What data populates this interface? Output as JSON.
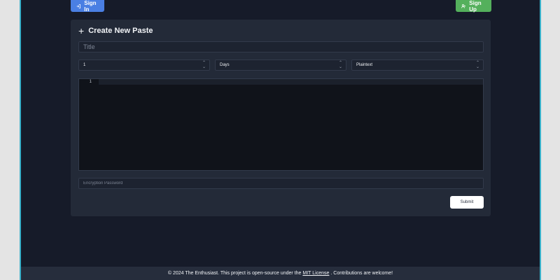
{
  "header": {
    "signin_label": "Sign In",
    "signup_label": "Sign Up"
  },
  "form": {
    "title": "Create New Paste",
    "title_placeholder": "Title",
    "expiry_value": "1",
    "expiry_unit": "Days",
    "syntax": "Plaintext",
    "editor_line_number": "1",
    "password_placeholder": "Encryption Password",
    "submit_label": "Submit"
  },
  "footer": {
    "prefix": "© 2024 The Enthusiast. This project is open-source under the",
    "license_link": "MIT License",
    "suffix": ". Contributions are welcome!"
  },
  "colors": {
    "background": "#161b29",
    "card": "#232a38",
    "signin": "#4a7fe3",
    "signup": "#54b05c",
    "accent_border": "#3ab0c8"
  }
}
